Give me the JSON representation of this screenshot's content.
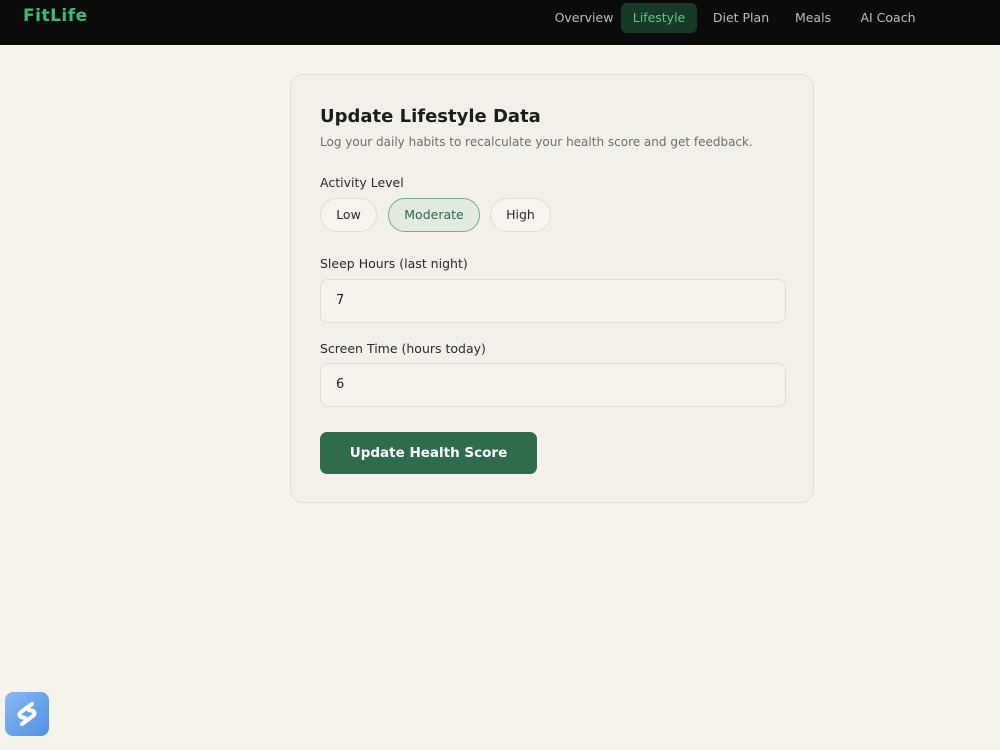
{
  "brand": {
    "name": "FitLife",
    "color": "#3dbb7a"
  },
  "nav": {
    "items": [
      {
        "label": "Overview",
        "active": false
      },
      {
        "label": "Lifestyle",
        "active": true
      },
      {
        "label": "Diet Plan",
        "active": false
      },
      {
        "label": "Meals",
        "active": false
      },
      {
        "label": "AI Coach",
        "active": false
      }
    ]
  },
  "form": {
    "title": "Update Lifestyle Data",
    "subtitle": "Log your daily habits to recalculate your health score and get feedback.",
    "activity": {
      "label": "Activity Level",
      "options": [
        "Low",
        "Moderate",
        "High"
      ],
      "selected": "Moderate"
    },
    "sleep": {
      "label": "Sleep Hours (last night)",
      "value": "7"
    },
    "screen": {
      "label": "Screen Time (hours today)",
      "value": "6"
    },
    "submit_label": "Update Health Score"
  },
  "colors": {
    "accent": "#2f6c4c",
    "background": "#f5f3ec",
    "topbar": "#0b0b0b"
  },
  "widget": {
    "icon": "app-shortcut-icon"
  }
}
